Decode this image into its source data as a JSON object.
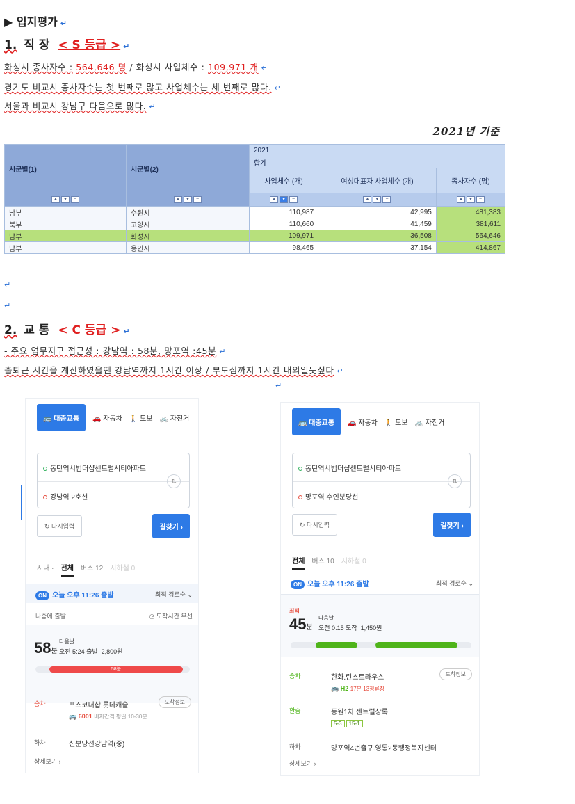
{
  "heading": "▶ 입지평가",
  "section1": {
    "number": "1.",
    "label": "직 장",
    "grade": "< S 등급 >",
    "line1_a": "화성시 종사자수 :",
    "line1_b": "564,646 명",
    "line1_c": " / 화성시 사업체수 :",
    "line1_d": "109,971 개",
    "line2": "경기도 비교시 종사자수는 첫 번째로 많고 사업체수는 세 번째로 많다.",
    "line3": "서울과 비교시 강남구 다음으로 많다."
  },
  "basis_label": "2021년 기준",
  "table": {
    "col1": "시군별(1)",
    "col2": "시군별(2)",
    "year": "2021",
    "total": "합계",
    "h_business": "사업체수 (개)",
    "h_female": "여성대표자 사업체수 (개)",
    "h_workers": "종사자수 (명)",
    "rows": [
      {
        "region": "남부",
        "city": "수원시",
        "business": "110,987",
        "female": "42,995",
        "workers": "481,383"
      },
      {
        "region": "북부",
        "city": "고양시",
        "business": "110,660",
        "female": "41,459",
        "workers": "381,611"
      },
      {
        "region": "남부",
        "city": "화성시",
        "business": "109,971",
        "female": "36,508",
        "workers": "564,646"
      },
      {
        "region": "남부",
        "city": "용인시",
        "business": "98,465",
        "female": "37,154",
        "workers": "414,867"
      }
    ]
  },
  "section2": {
    "number": "2.",
    "label": "교 통",
    "grade": "< C 등급 >",
    "line1": "- 주요 업무지구 접근성 : 강남역 : 58분, 망포역 :45분",
    "line2": "출퇴근 시간을 계산하였을땐 강남역까지 1시간 이상 / 부도심까지 1시간 내외일듯싶다"
  },
  "return_mark": "↵",
  "left_card": {
    "tabs": [
      "대중교통",
      "자동차",
      "도보",
      "자전거"
    ],
    "origin": "동탄역시범더샵센트럴시티아파트",
    "destination": "강남역 2호선",
    "reset": "다시입력",
    "find": "길찾기 ›",
    "filters": [
      "시내 ·",
      "전체",
      "버스 12",
      "지하철 0"
    ],
    "on": "ON",
    "depart": "오늘 오후 11:26 출발",
    "sort": "최적 경로순 ⌄",
    "later_departure": "나중에 출발",
    "arrival_note": "도착시간 우선",
    "duration": "58",
    "duration_unit": "분",
    "next_day": "다음날",
    "arrive": "오전 5:24 출발",
    "fare": "2,800원",
    "bar_label": "58분",
    "stop1_tag": "승차",
    "stop1": "포스코더샵.롯데캐슬",
    "stop1_btn": "도착정보",
    "bus": "6001",
    "bus_note": "배차간격 평일 10-30분",
    "stop2_tag": "하차",
    "stop2": "신분당선강남역(중)",
    "more": "상세보기 ›"
  },
  "right_card": {
    "tabs": [
      "대중교통",
      "자동차",
      "도보",
      "자전거"
    ],
    "origin": "동탄역시범더샵센트럴시티아파트",
    "destination": "망포역 수인분당선",
    "reset": "다시입력",
    "find": "길찾기 ›",
    "filters": [
      "전체",
      "버스 10",
      "지하철 0"
    ],
    "on": "ON",
    "depart": "오늘 오후 11:26 출발",
    "sort": "최적 경로순 ⌄",
    "best": "최적",
    "duration": "45",
    "duration_unit": "분",
    "next_day": "다음날",
    "arrive": "오전 0:15 도착",
    "fare": "1,450원",
    "stop1_tag": "승차",
    "stop1": "한화.린스트라우스",
    "stop1_btn": "도착정보",
    "bus": "H2",
    "bus_note": "17분 13정류장",
    "stop2_tag": "환승",
    "stop2": "동원1차.센트럴상록",
    "bus_tags": [
      "5-3",
      "15-1"
    ],
    "stop3_tag": "하차",
    "stop3": "망포역4번출구.영통2동행정복지센터",
    "more": "상세보기 ›"
  },
  "colors": {
    "accent": "#2d7ae6",
    "red": "#e02020",
    "table_header": "#8ea9d8",
    "highlight": "#b7e07c"
  }
}
